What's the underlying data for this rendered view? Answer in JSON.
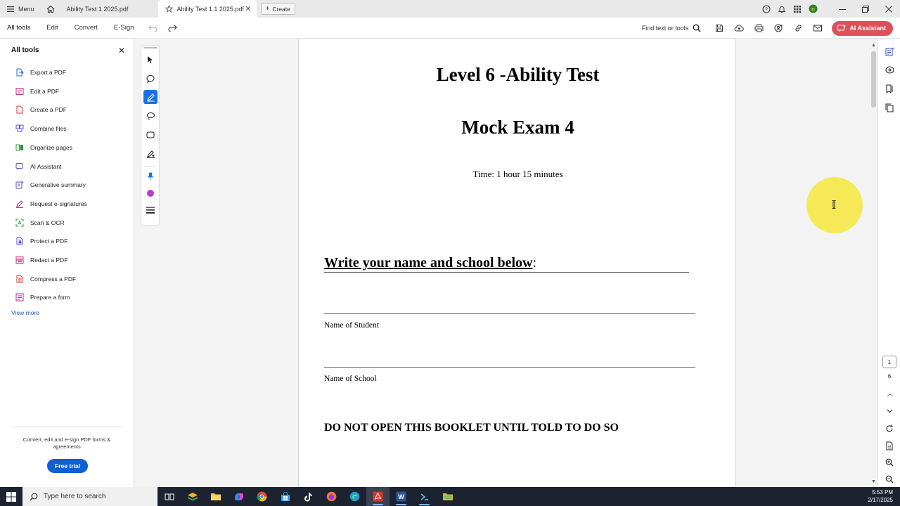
{
  "titlebar": {
    "menu_label": "Menu",
    "tabs": [
      {
        "label": "Ability Test 1 2025.pdf",
        "active": false
      },
      {
        "label": "Ability Test 1.1 2025.pdf",
        "active": true
      }
    ],
    "create_label": "Create",
    "avatar_initial": "n"
  },
  "toolbar": {
    "menu_tabs": [
      "All tools",
      "Edit",
      "Convert",
      "E-Sign"
    ],
    "find_label": "Find text or tools",
    "ai_label": "AI Assistant"
  },
  "left_panel": {
    "title": "All tools",
    "tools": [
      {
        "label": "Export a PDF",
        "icon": "export-pdf-icon",
        "color": "#1e6fd9"
      },
      {
        "label": "Edit a PDF",
        "icon": "edit-pdf-icon",
        "color": "#c42b7a"
      },
      {
        "label": "Create a PDF",
        "icon": "create-pdf-icon",
        "color": "#d9342b"
      },
      {
        "label": "Combine files",
        "icon": "combine-files-icon",
        "color": "#5a4fd6"
      },
      {
        "label": "Organize pages",
        "icon": "organize-pages-icon",
        "color": "#2a9d3a"
      },
      {
        "label": "AI Assistant",
        "icon": "ai-assistant-icon",
        "color": "#5a4fd6"
      },
      {
        "label": "Generative summary",
        "icon": "generative-summary-icon",
        "color": "#5a4fd6"
      },
      {
        "label": "Request e-signatures",
        "icon": "request-esignatures-icon",
        "color": "#b02a8e"
      },
      {
        "label": "Scan & OCR",
        "icon": "scan-ocr-icon",
        "color": "#2a9d3a"
      },
      {
        "label": "Protect a PDF",
        "icon": "protect-pdf-icon",
        "color": "#5a4fd6"
      },
      {
        "label": "Redact a PDF",
        "icon": "redact-pdf-icon",
        "color": "#c42b7a"
      },
      {
        "label": "Compress a PDF",
        "icon": "compress-pdf-icon",
        "color": "#d9342b"
      },
      {
        "label": "Prepare a form",
        "icon": "prepare-form-icon",
        "color": "#b02a8e"
      }
    ],
    "view_more": "View more",
    "promo_text": "Convert, edit and e-sign PDF forms & agreements",
    "trial_button": "Free trial"
  },
  "document": {
    "title": "Level 6 -Ability Test",
    "subtitle": "Mock Exam 4",
    "time": "Time: 1 hour 15 minutes",
    "write_heading": "Write your name and school below",
    "write_colon": ":",
    "name_label": "Name of Student",
    "school_label": "Name of School",
    "warning": "DO NOT OPEN THIS BOOKLET UNTIL TOLD TO DO SO"
  },
  "page_nav": {
    "current": "1",
    "total": "6"
  },
  "taskbar": {
    "search_placeholder": "Type here to search",
    "time": "5:53 PM",
    "date": "2/17/2025"
  },
  "colors": {
    "accent": "#1473e6",
    "ai_button": "#e0505a",
    "trial_button": "#1160cf",
    "cursor_highlight": "#f5e84a",
    "taskbar": "#1c2230"
  }
}
